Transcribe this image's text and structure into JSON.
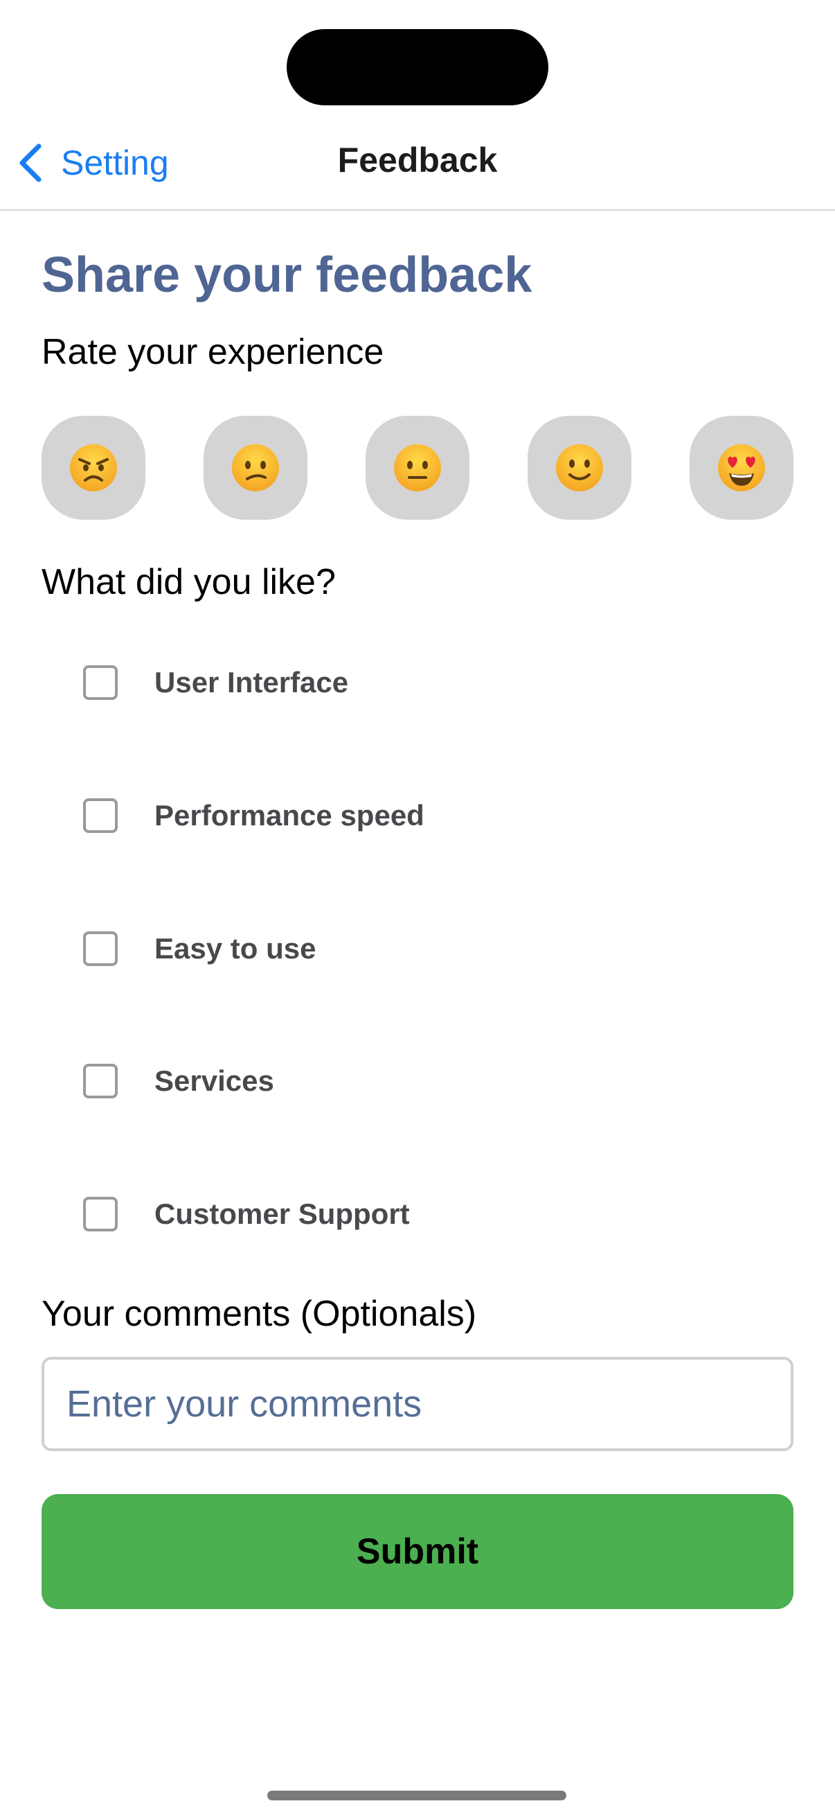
{
  "nav": {
    "back_label": "Setting",
    "title": "Feedback"
  },
  "form": {
    "heading": "Share your feedback",
    "rating_label": "Rate your experience",
    "ratings": [
      {
        "icon": "angry-face-icon"
      },
      {
        "icon": "confused-face-icon"
      },
      {
        "icon": "neutral-face-icon"
      },
      {
        "icon": "slightly-smiling-face-icon"
      },
      {
        "icon": "heart-eyes-face-icon"
      }
    ],
    "likes_label": "What did you like?",
    "options": [
      {
        "label": "User Interface",
        "checked": false
      },
      {
        "label": "Performance speed",
        "checked": false
      },
      {
        "label": "Easy to use",
        "checked": false
      },
      {
        "label": "Services",
        "checked": false
      },
      {
        "label": "Customer Support",
        "checked": false
      }
    ],
    "comments_label": "Your comments (Optionals)",
    "comments_placeholder": "Enter your comments",
    "comments_value": "",
    "submit_label": "Submit"
  },
  "colors": {
    "accent": "#1a7ef2",
    "heading": "#4f6593",
    "submit": "#4caf50",
    "rating_bg": "#d4d4d4"
  }
}
